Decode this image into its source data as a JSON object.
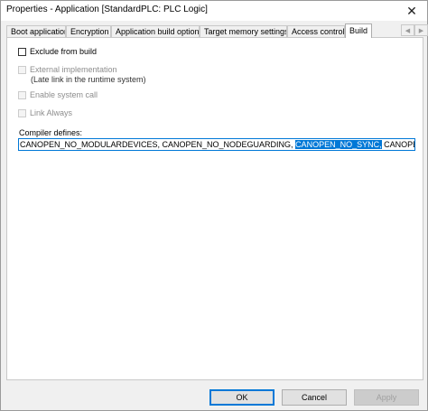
{
  "window": {
    "title": "Properties - Application [StandardPLC: PLC Logic]",
    "close_glyph": "✕"
  },
  "tabs": [
    {
      "label": "Boot application",
      "active": false
    },
    {
      "label": "Encryption",
      "active": false
    },
    {
      "label": "Application build options",
      "active": false
    },
    {
      "label": "Target memory settings",
      "active": false
    },
    {
      "label": "Access control",
      "active": false
    },
    {
      "label": "Build",
      "active": true
    }
  ],
  "tab_scroll": {
    "left_icon": "chevron-left-icon",
    "right_icon": "chevron-right-icon",
    "left_glyph": "◀",
    "right_glyph": "▶"
  },
  "build": {
    "exclude_from_build": {
      "label": "Exclude from build",
      "checked": false,
      "enabled": true
    },
    "external_implementation": {
      "label": "External implementation",
      "checked": false,
      "enabled": false
    },
    "late_link_note": "(Late link in the runtime system)",
    "enable_system_call": {
      "label": "Enable system call",
      "checked": false,
      "enabled": false
    },
    "link_always": {
      "label": "Link Always",
      "checked": false,
      "enabled": false
    },
    "compiler_defines": {
      "label": "Compiler defines:",
      "text_before": "CANOPEN_NO_MODULARDEVICES, CANOPEN_NO_NODEGUARDING, ",
      "text_selected": "CANOPEN_NO_SYNC,",
      "text_after": " CANOPEN_NO_TIMESTAMP"
    }
  },
  "buttons": {
    "ok": "OK",
    "cancel": "Cancel",
    "apply": "Apply"
  },
  "colors": {
    "accent": "#0078d7",
    "dialog_bg": "#f0f0f0",
    "panel_bg": "#ffffff"
  }
}
